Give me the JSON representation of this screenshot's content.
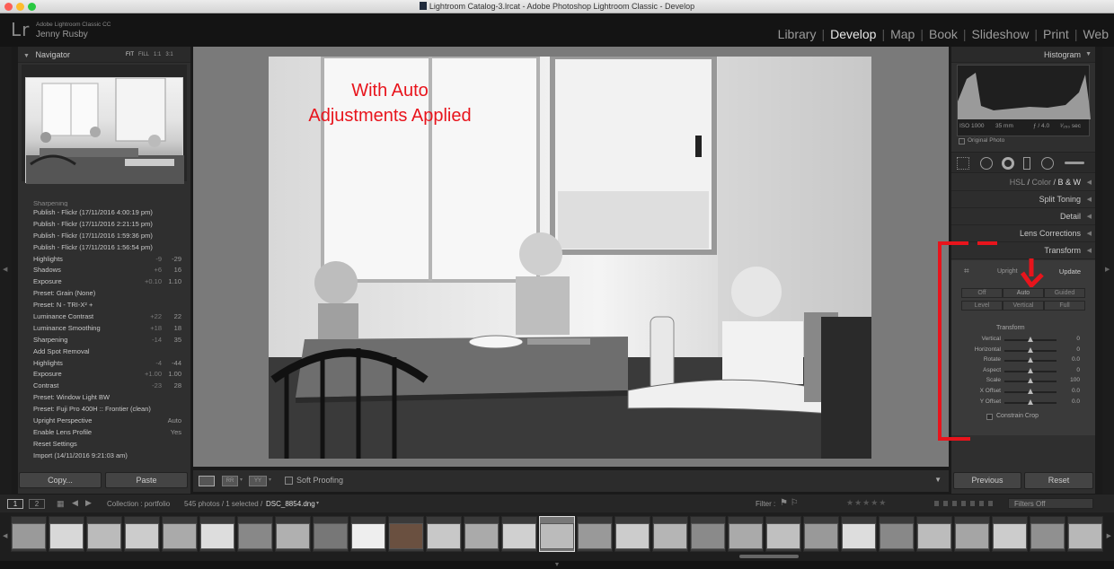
{
  "window": {
    "title": "Lightroom Catalog-3.lrcat - Adobe Photoshop Lightroom Classic - Develop"
  },
  "identity": {
    "logo": "Lr",
    "product": "Adobe Lightroom Classic CC",
    "user": "Jenny Rusby"
  },
  "modules": [
    "Library",
    "Develop",
    "Map",
    "Book",
    "Slideshow",
    "Print",
    "Web"
  ],
  "navigator": {
    "title": "Navigator",
    "options": [
      "FIT",
      "FILL",
      "1:1",
      "3:1"
    ]
  },
  "history": {
    "cut_label": "Sharpening",
    "items": [
      {
        "label": "Publish - Flickr (17/11/2016 4:00:19 pm)",
        "a": "",
        "b": ""
      },
      {
        "label": "Publish - Flickr (17/11/2016 2:21:15 pm)",
        "a": "",
        "b": ""
      },
      {
        "label": "Publish - Flickr (17/11/2016 1:59:36 pm)",
        "a": "",
        "b": ""
      },
      {
        "label": "Publish - Flickr (17/11/2016 1:56:54 pm)",
        "a": "",
        "b": ""
      },
      {
        "label": "Highlights",
        "a": "-9",
        "b": "-29"
      },
      {
        "label": "Shadows",
        "a": "+6",
        "b": "16"
      },
      {
        "label": "Exposure",
        "a": "+0.10",
        "b": "1.10"
      },
      {
        "label": "Preset: Grain (None)",
        "a": "",
        "b": ""
      },
      {
        "label": "Preset: N - TRI-X² +",
        "a": "",
        "b": ""
      },
      {
        "label": "Luminance Contrast",
        "a": "+22",
        "b": "22"
      },
      {
        "label": "Luminance Smoothing",
        "a": "+18",
        "b": "18"
      },
      {
        "label": "Sharpening",
        "a": "-14",
        "b": "35"
      },
      {
        "label": "Add Spot Removal",
        "a": "",
        "b": ""
      },
      {
        "label": "Highlights",
        "a": "-4",
        "b": "-44"
      },
      {
        "label": "Exposure",
        "a": "+1.00",
        "b": "1.00"
      },
      {
        "label": "Contrast",
        "a": "-23",
        "b": "28"
      },
      {
        "label": "Preset: Window Light BW",
        "a": "",
        "b": ""
      },
      {
        "label": "Preset: Fuji Pro 400H :: Frontier (clean)",
        "a": "",
        "b": ""
      },
      {
        "label": "Upright Perspective",
        "a": "",
        "b": "Auto"
      },
      {
        "label": "Enable Lens Profile",
        "a": "",
        "b": "Yes"
      },
      {
        "label": "Reset Settings",
        "a": "",
        "b": ""
      },
      {
        "label": "Import (14/11/2016 9:21:03 am)",
        "a": "",
        "b": ""
      }
    ]
  },
  "left_buttons": {
    "copy": "Copy...",
    "paste": "Paste"
  },
  "annotation": {
    "line1": "With Auto",
    "line2": "Adjustments Applied"
  },
  "toolbar": {
    "soft_proofing": "Soft Proofing"
  },
  "histogram": {
    "title": "Histogram",
    "iso": "ISO 1000",
    "focal": "35 mm",
    "aperture": "ƒ / 4.0",
    "shutter": "¹⁄₂₅₀ sec",
    "original": "Original Photo"
  },
  "right_sections": {
    "hsl": "HSL",
    "color": "Color",
    "bw": "B & W",
    "split": "Split Toning",
    "detail": "Detail",
    "lens": "Lens Corrections",
    "transform": "Transform"
  },
  "transform": {
    "upright": "Upright",
    "update": "Update",
    "modes": [
      "Off",
      "Auto",
      "Guided",
      "Level",
      "Vertical",
      "Full"
    ],
    "sub": "Transform",
    "sliders": [
      {
        "label": "Vertical",
        "value": "0",
        "pos": 0.5
      },
      {
        "label": "Horizontal",
        "value": "0",
        "pos": 0.5
      },
      {
        "label": "Rotate",
        "value": "0.0",
        "pos": 0.5
      },
      {
        "label": "Aspect",
        "value": "0",
        "pos": 0.5
      },
      {
        "label": "Scale",
        "value": "100",
        "pos": 0.5
      },
      {
        "label": "X Offset",
        "value": "0.0",
        "pos": 0.5
      },
      {
        "label": "Y Offset",
        "value": "0.0",
        "pos": 0.5
      }
    ],
    "constrain": "Constrain Crop"
  },
  "right_buttons": {
    "previous": "Previous",
    "reset": "Reset"
  },
  "filmstrip_bar": {
    "page1": "1",
    "page2": "2",
    "collection": "Collection : portfolio",
    "count": "545 photos / 1 selected /",
    "file": "DSC_8854.dng",
    "filter_label": "Filter :",
    "filters_off": "Filters Off"
  },
  "colors": {
    "accent_red": "#e8141c"
  }
}
